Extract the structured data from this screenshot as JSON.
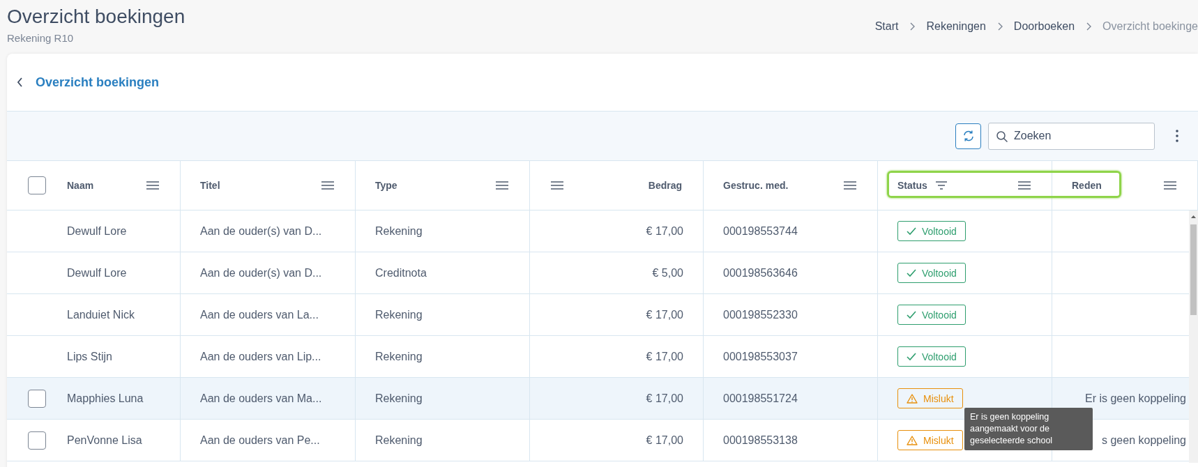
{
  "page": {
    "title": "Overzicht boekingen",
    "subtitle": "Rekening R10"
  },
  "breadcrumbs": [
    {
      "label": "Start",
      "current": false
    },
    {
      "label": "Rekeningen",
      "current": false
    },
    {
      "label": "Doorboeken",
      "current": false
    },
    {
      "label": "Overzicht boekinge",
      "current": true
    }
  ],
  "card": {
    "back_title": "Overzicht boekingen"
  },
  "toolbar": {
    "search": {
      "placeholder": "Zoeken"
    }
  },
  "table": {
    "select_all": {
      "checked": false
    },
    "columns": [
      {
        "label": "Naam",
        "kind": "text",
        "filtered": false,
        "highlighted": false
      },
      {
        "label": "Titel",
        "kind": "text",
        "filtered": false,
        "highlighted": false
      },
      {
        "label": "Type",
        "kind": "text",
        "filtered": false,
        "highlighted": false
      },
      {
        "label": "Bedrag",
        "kind": "amount",
        "filtered": false,
        "highlighted": false
      },
      {
        "label": "Gestruc. med.",
        "kind": "text",
        "filtered": false,
        "highlighted": false
      },
      {
        "label": "Status",
        "kind": "text",
        "filtered": true,
        "highlighted": true
      },
      {
        "label": "Reden",
        "kind": "text",
        "filtered": false,
        "highlighted": true
      }
    ],
    "rows": [
      {
        "selectable": false,
        "highlighted": false,
        "naam": "Dewulf Lore",
        "titel": "Aan de ouder(s) van D...",
        "type": "Rekening",
        "bedrag": "€ 17,00",
        "gestruc": "000198553744",
        "status": {
          "label": "Voltooid",
          "kind": "success"
        }
      },
      {
        "selectable": false,
        "highlighted": false,
        "naam": "Dewulf Lore",
        "titel": "Aan de ouder(s) van D...",
        "type": "Creditnota",
        "bedrag": "€ 5,00",
        "gestruc": "000198563646",
        "status": {
          "label": "Voltooid",
          "kind": "success"
        }
      },
      {
        "selectable": false,
        "highlighted": false,
        "naam": "Landuiet Nick",
        "titel": "Aan de ouders van La...",
        "type": "Rekening",
        "bedrag": "€ 17,00",
        "gestruc": "000198552330",
        "status": {
          "label": "Voltooid",
          "kind": "success"
        }
      },
      {
        "selectable": false,
        "highlighted": false,
        "naam": "Lips Stijn",
        "titel": "Aan de ouders van Lip...",
        "type": "Rekening",
        "bedrag": "€ 17,00",
        "gestruc": "000198553037",
        "status": {
          "label": "Voltooid",
          "kind": "success"
        }
      },
      {
        "selectable": true,
        "checked": false,
        "highlighted": true,
        "naam": "Mapphies Luna",
        "titel": "Aan de ouders van Ma...",
        "type": "Rekening",
        "bedrag": "€ 17,00",
        "gestruc": "000198551724",
        "status": {
          "label": "Mislukt",
          "kind": "failed"
        },
        "reden": "Er is geen koppeling"
      },
      {
        "selectable": true,
        "checked": false,
        "highlighted": false,
        "naam": "PenVonne Lisa",
        "titel": "Aan de ouders van Pe...",
        "type": "Rekening",
        "bedrag": "€ 17,00",
        "gestruc": "000198553138",
        "status": {
          "label": "Mislukt",
          "kind": "failed"
        },
        "reden": "s geen koppeling"
      }
    ],
    "tooltip": {
      "text": "Er is geen koppeling aangemaakt voor de geselecteerde school"
    }
  }
}
